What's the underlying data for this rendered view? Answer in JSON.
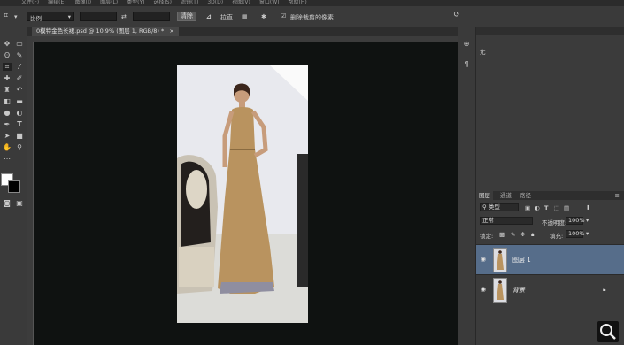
{
  "menu": [
    "文件(F)",
    "编辑(E)",
    "图像(I)",
    "图层(L)",
    "类型(Y)",
    "选择(S)",
    "滤镜(T)",
    "3D(D)",
    "视图(V)",
    "窗口(W)",
    "帮助(H)"
  ],
  "options": {
    "ratio_select": "比例",
    "clear_button": "清除",
    "straighten_label": "拉直",
    "delete_cropped_label": "删除裁剪的像素",
    "delete_cropped_checked": true
  },
  "document": {
    "tab_label": "0模特金色长裙.psd @ 10.9% (图层 1, RGB/8) *",
    "close_glyph": "×"
  },
  "panel_top": {
    "label": "尢"
  },
  "layers_panel": {
    "tabs": [
      "图层",
      "通道",
      "路径"
    ],
    "filter_label": "类型",
    "blend_mode": "正常",
    "opacity_label": "不透明度:",
    "opacity_value": "100%",
    "lock_label": "锁定:",
    "fill_label": "填充:",
    "fill_value": "100%",
    "layers": [
      {
        "name": "图层 1",
        "selected": true
      },
      {
        "name": "背景",
        "selected": false,
        "locked": true
      }
    ]
  },
  "colors": {
    "canvas": "#0f1211",
    "panel": "#3b3b3b",
    "selected_layer": "#566d8a",
    "dress": "#b9935f"
  }
}
